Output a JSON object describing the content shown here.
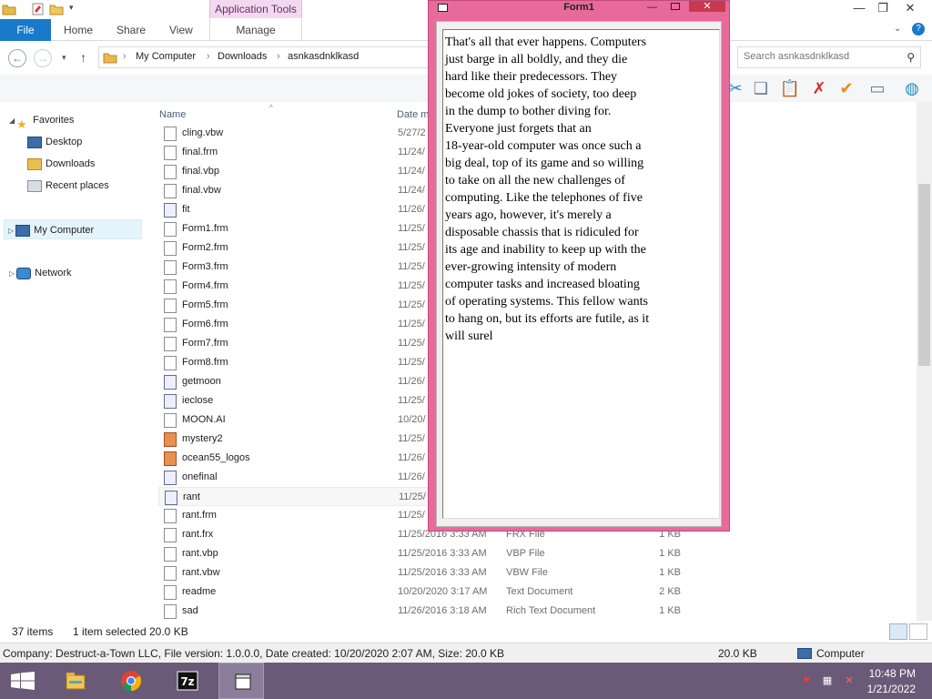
{
  "ribbon": {
    "contextual_tab": "Application Tools",
    "tabs": [
      "File",
      "Home",
      "Share",
      "View",
      "Manage"
    ]
  },
  "address": {
    "breadcrumb": [
      "My Computer",
      "Downloads",
      "asnkasdnklkasd"
    ]
  },
  "search": {
    "placeholder": "Search asnkasdnklkasd"
  },
  "nav": {
    "favorites": "Favorites",
    "desktop": "Desktop",
    "downloads": "Downloads",
    "recent": "Recent places",
    "mycomputer": "My Computer",
    "network": "Network"
  },
  "columns": {
    "name": "Name",
    "date": "Date m"
  },
  "files": [
    {
      "name": "cling.vbw",
      "date": "5/27/2",
      "type": "",
      "size": "",
      "icon": "doc"
    },
    {
      "name": "final.frm",
      "date": "11/24/",
      "type": "",
      "size": "",
      "icon": "doc"
    },
    {
      "name": "final.vbp",
      "date": "11/24/",
      "type": "",
      "size": "",
      "icon": "doc"
    },
    {
      "name": "final.vbw",
      "date": "11/24/",
      "type": "",
      "size": "",
      "icon": "doc"
    },
    {
      "name": "fit",
      "date": "11/26/",
      "type": "",
      "size": "",
      "icon": "exe"
    },
    {
      "name": "Form1.frm",
      "date": "11/25/",
      "type": "",
      "size": "",
      "icon": "doc"
    },
    {
      "name": "Form2.frm",
      "date": "11/25/",
      "type": "",
      "size": "",
      "icon": "doc"
    },
    {
      "name": "Form3.frm",
      "date": "11/25/",
      "type": "",
      "size": "",
      "icon": "doc"
    },
    {
      "name": "Form4.frm",
      "date": "11/25/",
      "type": "",
      "size": "",
      "icon": "doc"
    },
    {
      "name": "Form5.frm",
      "date": "11/25/",
      "type": "",
      "size": "",
      "icon": "doc"
    },
    {
      "name": "Form6.frm",
      "date": "11/25/",
      "type": "",
      "size": "",
      "icon": "doc"
    },
    {
      "name": "Form7.frm",
      "date": "11/25/",
      "type": "",
      "size": "",
      "icon": "doc"
    },
    {
      "name": "Form8.frm",
      "date": "11/25/",
      "type": "",
      "size": "",
      "icon": "doc"
    },
    {
      "name": "getmoon",
      "date": "11/26/",
      "type": "",
      "size": "",
      "icon": "exe"
    },
    {
      "name": "ieclose",
      "date": "11/25/",
      "type": "",
      "size": "",
      "icon": "exe"
    },
    {
      "name": "MOON.AI",
      "date": "10/20/",
      "type": "",
      "size": "",
      "icon": "doc"
    },
    {
      "name": "mystery2",
      "date": "11/25/",
      "type": "",
      "size": "",
      "icon": "img"
    },
    {
      "name": "ocean55_logos",
      "date": "11/26/",
      "type": "",
      "size": "",
      "icon": "img"
    },
    {
      "name": "onefinal",
      "date": "11/26/",
      "type": "",
      "size": "",
      "icon": "exe"
    },
    {
      "name": "rant",
      "date": "11/25/",
      "type": "",
      "size": "",
      "icon": "exe"
    },
    {
      "name": "rant.frm",
      "date": "11/25/",
      "type": "",
      "size": "",
      "icon": "doc"
    },
    {
      "name": "rant.frx",
      "date": "11/25/2016 3:33 AM",
      "type": "FRX File",
      "size": "1 KB",
      "icon": "doc"
    },
    {
      "name": "rant.vbp",
      "date": "11/25/2016 3:33 AM",
      "type": "VBP File",
      "size": "1 KB",
      "icon": "doc"
    },
    {
      "name": "rant.vbw",
      "date": "11/25/2016 3:33 AM",
      "type": "VBW File",
      "size": "1 KB",
      "icon": "doc"
    },
    {
      "name": "readme",
      "date": "10/20/2020 3:17 AM",
      "type": "Text Document",
      "size": "2 KB",
      "icon": "doc"
    },
    {
      "name": "sad",
      "date": "11/26/2016 3:18 AM",
      "type": "Rich Text Document",
      "size": "1 KB",
      "icon": "doc"
    }
  ],
  "selected_file": "rant",
  "status": {
    "items": "37 items",
    "selected": "1 item selected",
    "size": "20.0 KB"
  },
  "details": {
    "info": "Company: Destruct-a-Town LLC, File version: 1.0.0.0, Date created: 10/20/2020 2:07 AM, Size: 20.0 KB",
    "size": "20.0 KB",
    "location": "Computer"
  },
  "form1": {
    "title": "Form1",
    "text": "That's all that ever happens. Computers\njust barge in all boldly, and they die\nhard like their predecessors. They\nbecome old jokes of society, too deep\nin the dump to bother diving for.\nEveryone just forgets that an\n18-year-old computer was once such a\nbig deal, top of its game and so willing\nto take on all the new challenges of\ncomputing. Like the telephones of five\nyears ago, however, it's merely a\ndisposable chassis that is ridiculed for\nits age and inability to keep up with the\never-growing intensity of modern\ncomputer tasks and increased bloating\nof operating systems. This fellow wants\nto hang on, but its efforts are futile, as it\nwill surel"
  },
  "taskbar": {
    "time": "10:48 PM",
    "date": "1/21/2022"
  }
}
